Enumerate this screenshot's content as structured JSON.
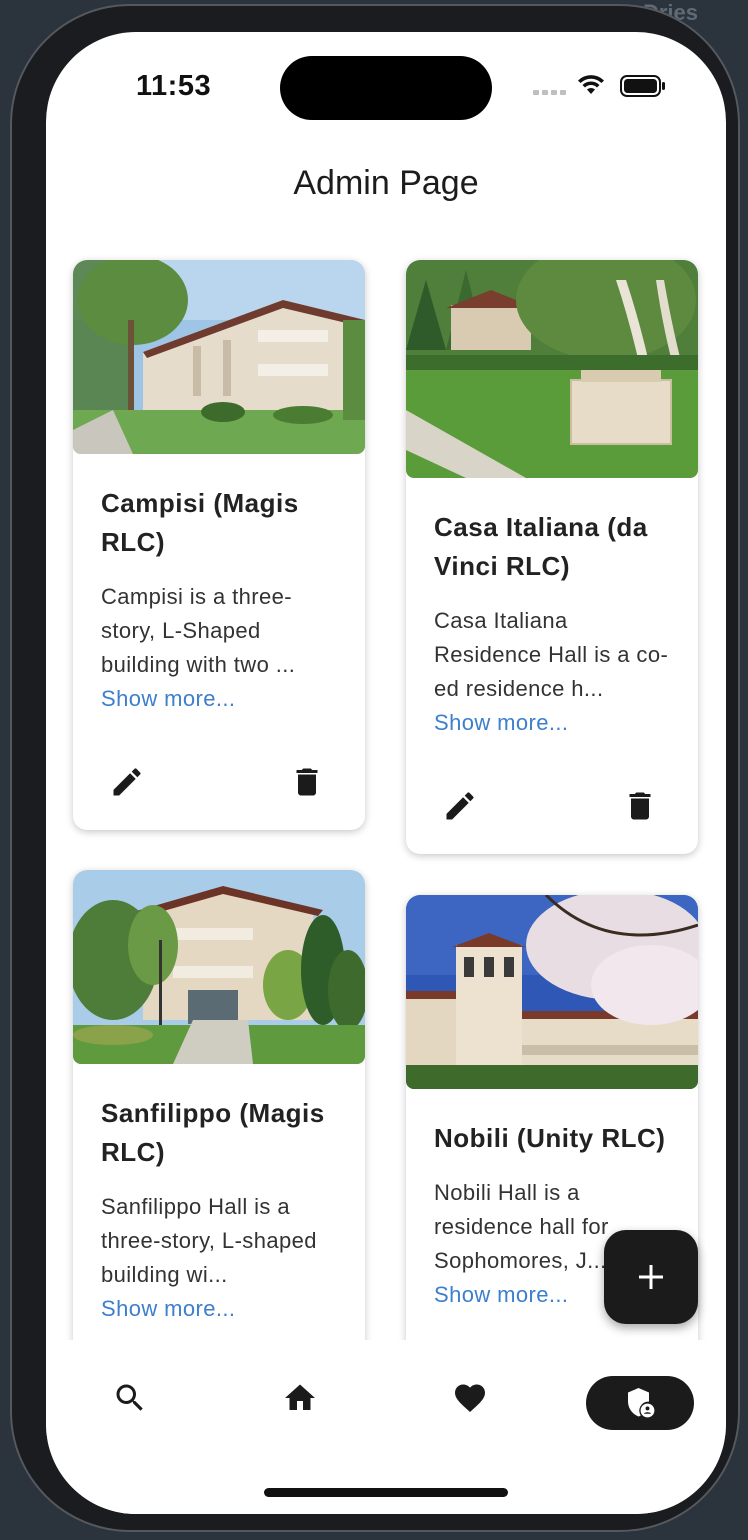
{
  "background_text": "Dries",
  "status_bar": {
    "time": "11:53"
  },
  "page": {
    "title": "Admin Page"
  },
  "cards": [
    {
      "name": "Campisi (Magis RLC)",
      "description": "Campisi is a three-story, L-Shaped building with two ...",
      "show_more": "Show more..."
    },
    {
      "name": "Casa Italiana (da Vinci RLC)",
      "description": "Casa Italiana Residence Hall is a co-ed residence h...",
      "show_more": "Show more..."
    },
    {
      "name": "Sanfilippo (Magis RLC)",
      "description": "Sanfilippo Hall is a three-story, L-shaped building wi...",
      "show_more": "Show more..."
    },
    {
      "name": "Nobili (Unity RLC)",
      "description": "Nobili Hall is a residence hall for Sophomores, J...",
      "show_more": "Show more..."
    }
  ],
  "fab": {
    "icon": "plus-icon"
  },
  "nav": [
    {
      "icon": "search-icon"
    },
    {
      "icon": "home-icon"
    },
    {
      "icon": "heart-icon"
    },
    {
      "icon": "admin-shield-icon",
      "active": true
    }
  ],
  "colors": {
    "link": "#3d7fcc",
    "accent_dark": "#1b1b1b"
  }
}
